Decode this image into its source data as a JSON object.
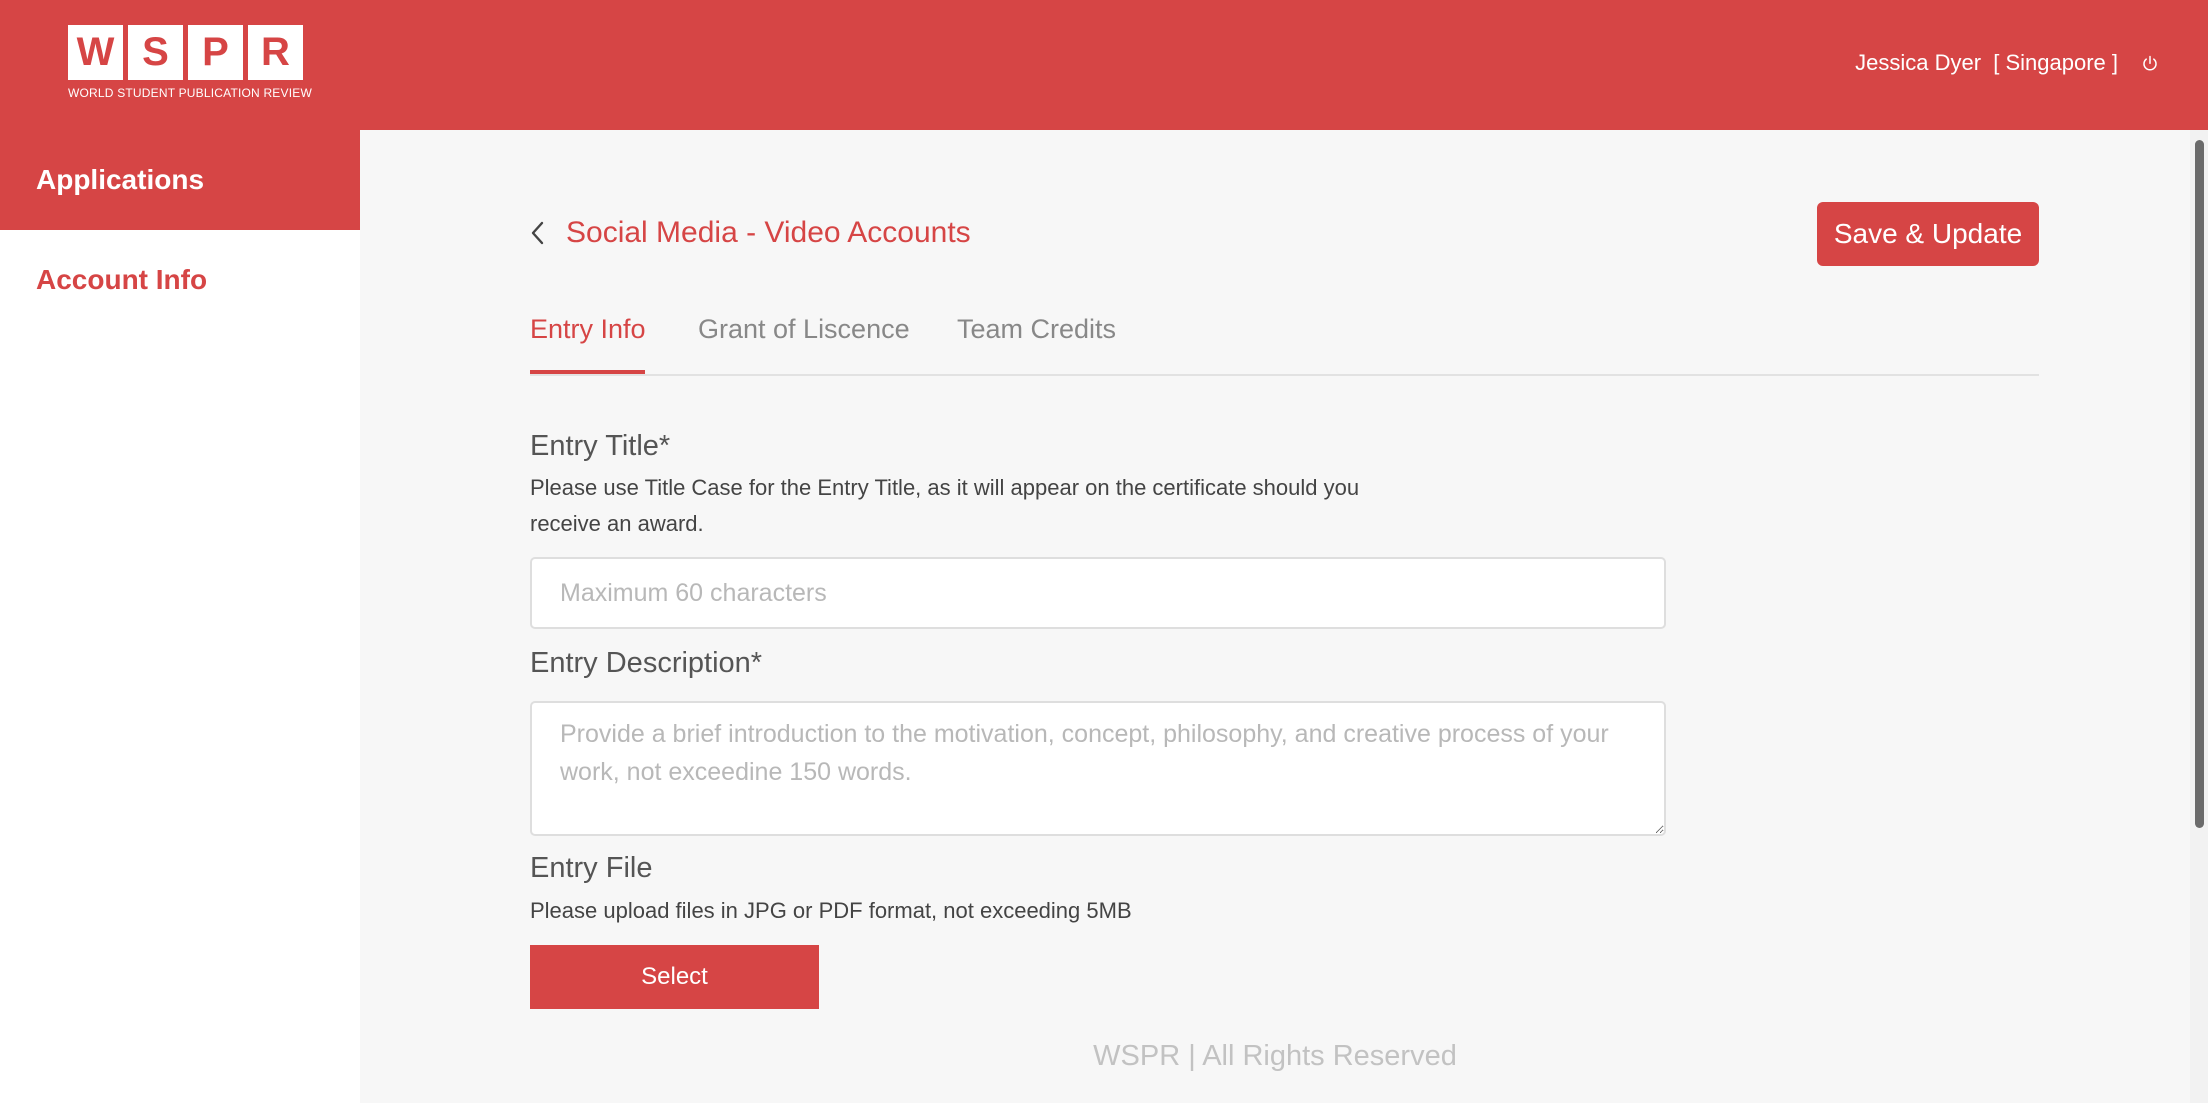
{
  "header": {
    "logo_letters": [
      "W",
      "S",
      "P",
      "R"
    ],
    "logo_subtitle": "WORLD STUDENT PUBLICATION REVIEW",
    "user_name": "Jessica Dyer",
    "user_location": "[ Singapore ]",
    "power_icon": "power-icon"
  },
  "sidebar": {
    "items": [
      {
        "label": "Applications",
        "active": true
      },
      {
        "label": "Account Info",
        "active": false
      }
    ]
  },
  "main": {
    "back_icon": "chevron-left-icon",
    "title": "Social Media - Video Accounts",
    "save_label": "Save & Update",
    "tabs": [
      {
        "label": "Entry Info",
        "active": true
      },
      {
        "label": "Grant of Liscence",
        "active": false
      },
      {
        "label": "Team Credits",
        "active": false
      }
    ],
    "entry_title": {
      "label": "Entry Title*",
      "help": "Please use Title Case for the Entry Title, as it will appear on the certificate should you receive an award.",
      "value": "",
      "placeholder": "Maximum 60 characters"
    },
    "entry_description": {
      "label": "Entry Description*",
      "value": "",
      "placeholder": "Provide a brief introduction to the motivation, concept, philosophy, and creative process of your work, not exceedine 150 words."
    },
    "entry_file": {
      "label": "Entry File",
      "help": "Please upload files in JPG or PDF format, not exceeding 5MB",
      "select_label": "Select"
    },
    "footer": "WSPR | All Rights Reserved"
  },
  "colors": {
    "brand": "#d64545",
    "background": "#f7f7f7",
    "placeholder": "#b8b8b8"
  }
}
